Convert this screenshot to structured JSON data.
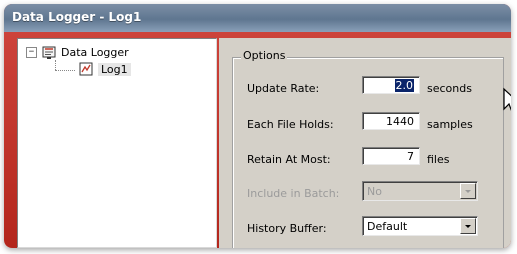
{
  "window": {
    "title": "Data Logger - Log1"
  },
  "tree": {
    "root": {
      "label": "Data Logger",
      "expander": "−"
    },
    "child": {
      "label": "Log1"
    }
  },
  "options": {
    "group_label": "Options",
    "update_rate": {
      "label": "Update Rate:",
      "value": "2.0",
      "unit": "seconds"
    },
    "file_holds": {
      "label": "Each File Holds:",
      "value": "1440",
      "unit": "samples"
    },
    "retain": {
      "label": "Retain At Most:",
      "value": "7",
      "unit": "files"
    },
    "include_batch": {
      "label": "Include in Batch:",
      "value": "No"
    },
    "history_buffer": {
      "label": "History Buffer:",
      "value": "Default"
    }
  },
  "colors": {
    "accent": "#b3261c",
    "selection": "#0a246a",
    "panel": "#d4d0c8"
  }
}
